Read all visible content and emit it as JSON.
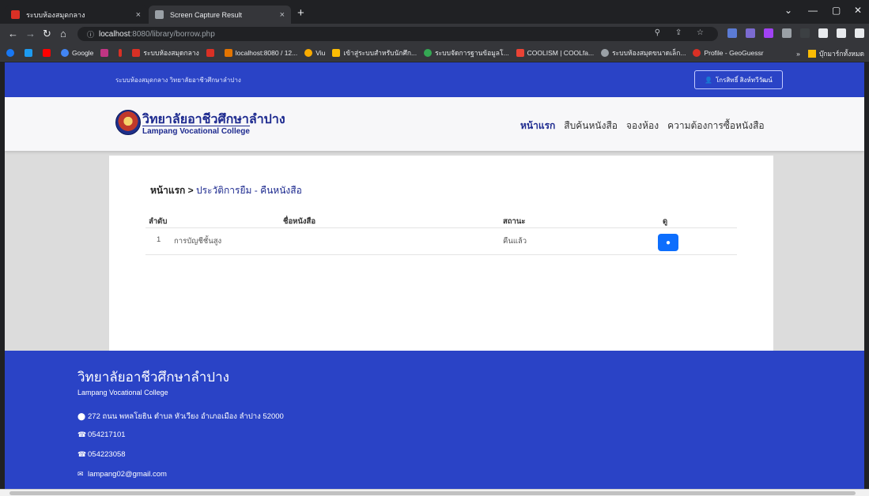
{
  "browser": {
    "tabs": [
      {
        "title": "ระบบห้องสมุดกลาง",
        "close": "×",
        "favicon_color": "#d93025"
      },
      {
        "title": "Screen Capture Result",
        "close": "×",
        "favicon_color": "#9aa0a6"
      }
    ],
    "new_tab": "+",
    "url_host": "localhost",
    "url_path": ":8080/library/borrow.php",
    "bookmarks": [
      {
        "label": "Google",
        "color": "#4285f4"
      },
      {
        "label": "ระบบห้องสมุดกลาง",
        "color": "#d93025"
      },
      {
        "label": "localhost:8080 / 12...",
        "color": "#e37400"
      },
      {
        "label": "Viu",
        "color": "#f9ab00"
      },
      {
        "label": "เข้าสู่ระบบสำหรับนักศึก...",
        "color": "#fbbc04"
      },
      {
        "label": "ระบบจัดการฐานข้อมูลโ...",
        "color": "#34a853"
      },
      {
        "label": "COOLISM | COOLfa...",
        "color": "#ea4335"
      },
      {
        "label": "ระบบห้องสมุดขนาดเล็ก...",
        "color": "#9aa0a6"
      },
      {
        "label": "Profile - GeoGuessr",
        "color": "#d93025"
      }
    ],
    "bookmarks_more": "»",
    "other_bookmarks": "บุ๊กมาร์กทั้งหมด"
  },
  "site": {
    "top_title": "ระบบห้องสมุดกลาง วิทยาลัยอาชีวศึกษาลำปาง",
    "user_name": "โกรสิทธิ์ สิงห์ทวีวัฒน์",
    "logo_th": "วิทยาลัยอาชีวศึกษาลำปาง",
    "logo_en": "Lampang Vocational College",
    "nav": [
      "หน้าแรก",
      "สืบค้นหนังสือ",
      "จองห้อง",
      "ความต้องการซื้อหนังสือ"
    ]
  },
  "main": {
    "breadcrumb_home": "หน้าแรก",
    "breadcrumb_sep": " > ",
    "breadcrumb_current": "ประวัติการยืม - คืนหนังสือ",
    "columns": [
      "ลำดับ",
      "ชื่อหนังสือ",
      "สถานะ",
      "ดู"
    ],
    "rows": [
      {
        "no": "1",
        "title": "การบัญชีชั้นสูง",
        "status": "คืนแล้ว"
      }
    ]
  },
  "footer": {
    "name_th": "วิทยาลัยอาชีวศึกษาลำปาง",
    "name_en": "Lampang Vocational College",
    "address": "272 ถนน พหลโยธิน ตำบล หัวเวียง อำเภอเมือง ลำปาง 52000",
    "phone1": "054217101",
    "phone2": "054223058",
    "email": "lampang02@gmail.com"
  },
  "colors": {
    "primary": "#2a43c6",
    "brand_text": "#1d2a8f",
    "button": "#0d6efd"
  }
}
